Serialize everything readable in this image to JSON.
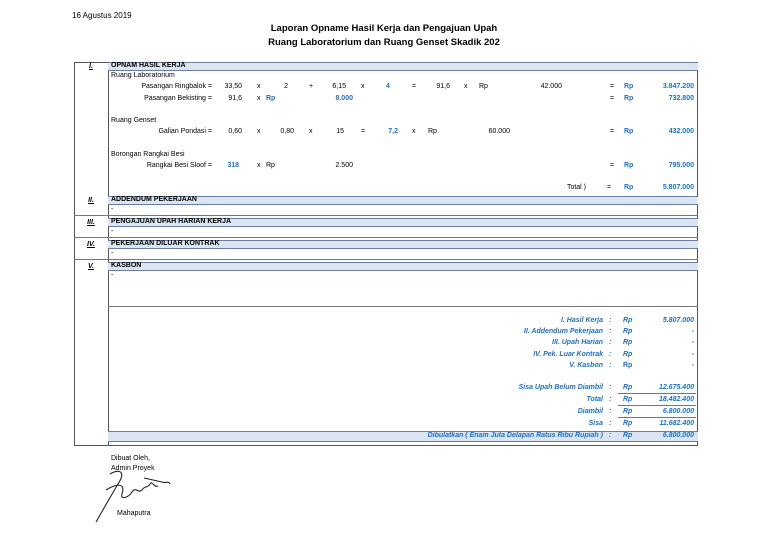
{
  "date": "16 Agustus 2019",
  "title1": "Laporan Opname Hasil Kerja dan Pengajuan Upah",
  "title2": "Ruang Laboratorium dan Ruang Genset Skadik 202",
  "sections": [
    {
      "roman": "I.",
      "label": "OPNAM HASIL KERJA"
    },
    {
      "roman": "II.",
      "label": "ADDENDUM PEKERJAAN"
    },
    {
      "roman": "III.",
      "label": "PENGAJUAN UPAH HARIAN KERJA"
    },
    {
      "roman": "IV.",
      "label": "PEKERJAAN DILUAR KONTRAK"
    },
    {
      "roman": "V.",
      "label": "KASBON"
    }
  ],
  "lab": {
    "heading": "Ruang Laboratorium",
    "row1": {
      "label": "Pasangan Ringbalok =",
      "a": "33,50",
      "x1": "x",
      "b": "2",
      "plus": "+",
      "c": "6,15",
      "x2": "x",
      "d": "4",
      "eq": "=",
      "e": "91,6",
      "x3": "x",
      "rp": "Rp",
      "price": "42.000",
      "eq2": "=",
      "rp2": "Rp",
      "total": "3.847.200"
    },
    "row2": {
      "label": "Pasangan Bekisting =",
      "a": "91,6",
      "x1": "x",
      "rp": "Rp",
      "price": "8.000",
      "eq2": "=",
      "rp2": "Rp",
      "total": "732.800"
    }
  },
  "genset": {
    "heading": "Ruang Genset",
    "row1": {
      "label": "Galian Pondasi =",
      "a": "0,60",
      "x1": "x",
      "b": "0,80",
      "x2": "x",
      "c": "15",
      "eq": "=",
      "d": "7,2",
      "x3": "x",
      "rp": "Rp",
      "price": "60.000",
      "eq2": "=",
      "rp2": "Rp",
      "total": "432.000"
    }
  },
  "besi": {
    "heading": "Borongan Rangkai Besi",
    "row1": {
      "label": "Rangkai Besi Sloof =",
      "a": "318",
      "x1": "x",
      "rp": "Rp",
      "price": "2.500",
      "eq2": "=",
      "rp2": "Rp",
      "total": "795.000"
    }
  },
  "total_row": {
    "label": "Total )",
    "eq": "=",
    "rp": "Rp",
    "value": "5.807.000"
  },
  "dash": "-",
  "summary": [
    {
      "label": "I. Hasil Kerja",
      "colon": ":",
      "rp": "Rp",
      "value": "5.807.000"
    },
    {
      "label": "II. Addendum Pekerjaan",
      "colon": ":",
      "rp": "Rp",
      "value": "-"
    },
    {
      "label": "III. Upah Harian",
      "colon": ":",
      "rp": "Rp",
      "value": "-"
    },
    {
      "label": "IV. Pek. Luar Kontrak",
      "colon": ":",
      "rp": "Rp",
      "value": "-"
    },
    {
      "label": "V. Kasbon",
      "colon": ":",
      "rp": "Rp",
      "value": "-"
    }
  ],
  "summary2": [
    {
      "label": "Sisa Upah Belum Diambil",
      "colon": ":",
      "rp": "Rp",
      "value": "12.675.400"
    },
    {
      "label": "Total",
      "colon": ":",
      "rp": "Rp",
      "value": "18.482.400"
    },
    {
      "label": "Diambil",
      "colon": ":",
      "rp": "Rp",
      "value": "6.800.000"
    },
    {
      "label": "Sisa",
      "colon": ":",
      "rp": "Rp",
      "value": "11.682.400"
    }
  ],
  "dibulatkan": {
    "label": "Dibulatkan ( Enam Juta Delapan Ratus Ribu Rupiah )",
    "colon": ":",
    "rp": "Rp",
    "value": "6.800.000"
  },
  "signature": {
    "line1": "Dibuat Oleh,",
    "line2": "Admin Proyek",
    "name": "Mahaputra"
  },
  "colors": {
    "accent": "#1f6fc5",
    "band": "#dbe5f1",
    "kasbon_rp": "#d22"
  }
}
